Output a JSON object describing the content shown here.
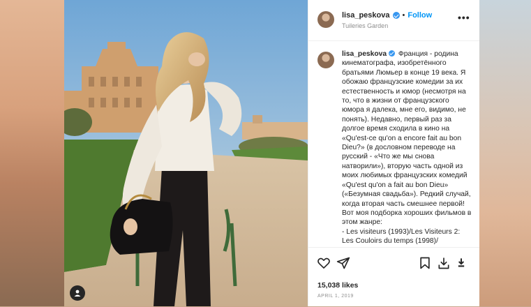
{
  "post": {
    "username": "lisa_peskova",
    "separator": "•",
    "follow_label": "Follow",
    "location": "Tuileries Garden",
    "more_label": "•••",
    "caption_username": "lisa_peskova",
    "caption_text": "Франция - родина кинематографа, изобретённого братьями Люмьер в конце 19 века. Я обожаю французские комедии за их естественность и юмор (несмотря на то, что в жизни от французского юмора я далека, мне его, видимо, не понять). Недавно, первый раз за долгое время сходила в кино на «Qu'est-ce qu'on a encore fait au bon Dieu?» (в дословном переводе на русский - «Что же мы снова натворили»), вторую часть одной из моих любимых французских комедий «Qu'est qu'on a fait au bon Dieu» («Безумная свадьба»). Редкий случай, когда вторая часть смешнее первой!\nВот моя подборка хороших фильмов в этом жанре:\n- Les visiteurs (1993)/Les Visiteurs 2: Les Couloirs du temps (1998)/",
    "likes": "15,038 likes",
    "date": "APRIL 1, 2019"
  },
  "icons": {
    "like": "heart-icon",
    "share": "send-icon",
    "save": "bookmark-icon",
    "download": "download-icon",
    "download2": "download-small-icon",
    "user_tag": "user-icon"
  },
  "colors": {
    "accent": "#0095f6",
    "verified": "#3897f0",
    "text": "#262626",
    "muted": "#8e8e8e"
  }
}
